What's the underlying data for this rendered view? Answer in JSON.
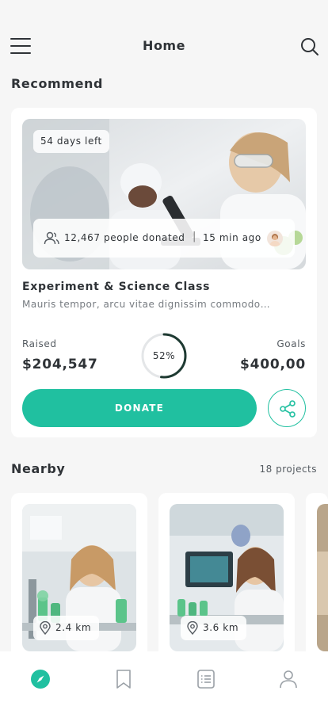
{
  "header": {
    "title": "Home",
    "menu_icon": "hamburger-menu-icon",
    "search_icon": "search-icon"
  },
  "recommend": {
    "section_title": "Recommend",
    "card": {
      "days_left": "54 days left",
      "donated": "12,467 people donated",
      "time_ago": "15 min ago",
      "name": "Experiment & Science Class",
      "description": "Mauris tempor, arcu vitae dignissim commodo…",
      "raised_label": "Raised",
      "raised_value": "$204,547",
      "goal_label": "Goals",
      "goal_value": "$400,00",
      "progress_text": "52%",
      "progress": 0.52,
      "donate_label": "DONATE",
      "share_icon": "share-icon"
    }
  },
  "nearby": {
    "section_title": "Nearby",
    "count": "18 projects",
    "items": [
      {
        "distance": "2.4 km"
      },
      {
        "distance": "3.6 km"
      }
    ]
  },
  "tabbar": {
    "tabs": [
      {
        "icon": "compass-icon",
        "active": true
      },
      {
        "icon": "bookmark-icon",
        "active": false
      },
      {
        "icon": "list-icon",
        "active": false
      },
      {
        "icon": "profile-icon",
        "active": false
      }
    ]
  },
  "colors": {
    "accent": "#20c0a0",
    "background": "#f6f6f6",
    "text": "#2f3337"
  }
}
